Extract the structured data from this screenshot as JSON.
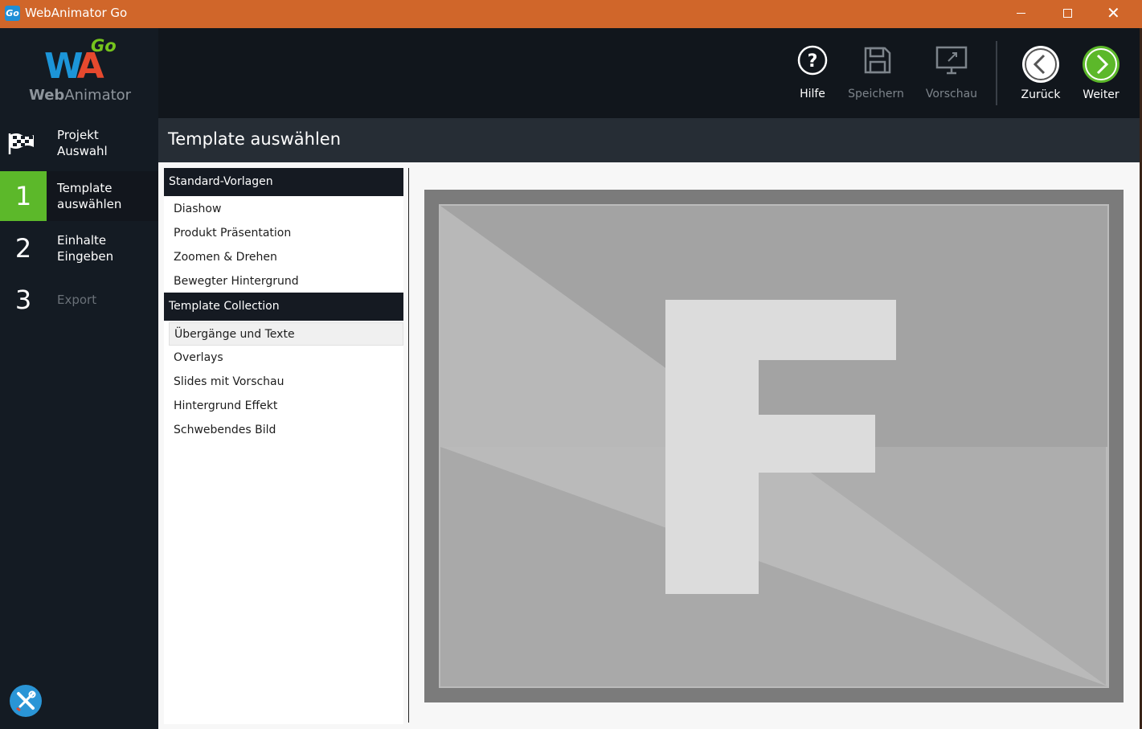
{
  "window": {
    "title": "WebAnimator Go",
    "app_icon": "Go"
  },
  "logo": {
    "wa_w": "W",
    "wa_a": "A",
    "go": "Go",
    "word_bold": "Web",
    "word_rest": "Animator"
  },
  "sidebar": {
    "project": {
      "label_1": "Projekt",
      "label_2": "Auswahl"
    },
    "steps": [
      {
        "num": "1",
        "label_1": "Template",
        "label_2": "auswählen"
      },
      {
        "num": "2",
        "label_1": "Einhalte",
        "label_2": "Eingeben"
      },
      {
        "num": "3",
        "label_1": "Export"
      }
    ]
  },
  "toolbar": {
    "help": "Hilfe",
    "save": "Speichern",
    "preview": "Vorschau",
    "back": "Zurück",
    "next": "Weiter"
  },
  "content": {
    "title": "Template auswählen",
    "groups": [
      {
        "header": "Standard-Vorlagen",
        "items": [
          "Diashow",
          "Produkt Präsentation",
          "Zoomen & Drehen",
          "Bewegter Hintergrund"
        ]
      },
      {
        "header": "Template Collection",
        "items": [
          "Übergänge und Texte",
          "Overlays",
          "Slides mit Vorschau",
          "Hintergrund Effekt",
          "Schwebendes Bild"
        ]
      }
    ],
    "selected_item": "Übergänge und Texte"
  },
  "colors": {
    "accent_green": "#5cb82a",
    "titlebar_orange": "#d0662a",
    "tools_blue": "#2a95d6"
  }
}
